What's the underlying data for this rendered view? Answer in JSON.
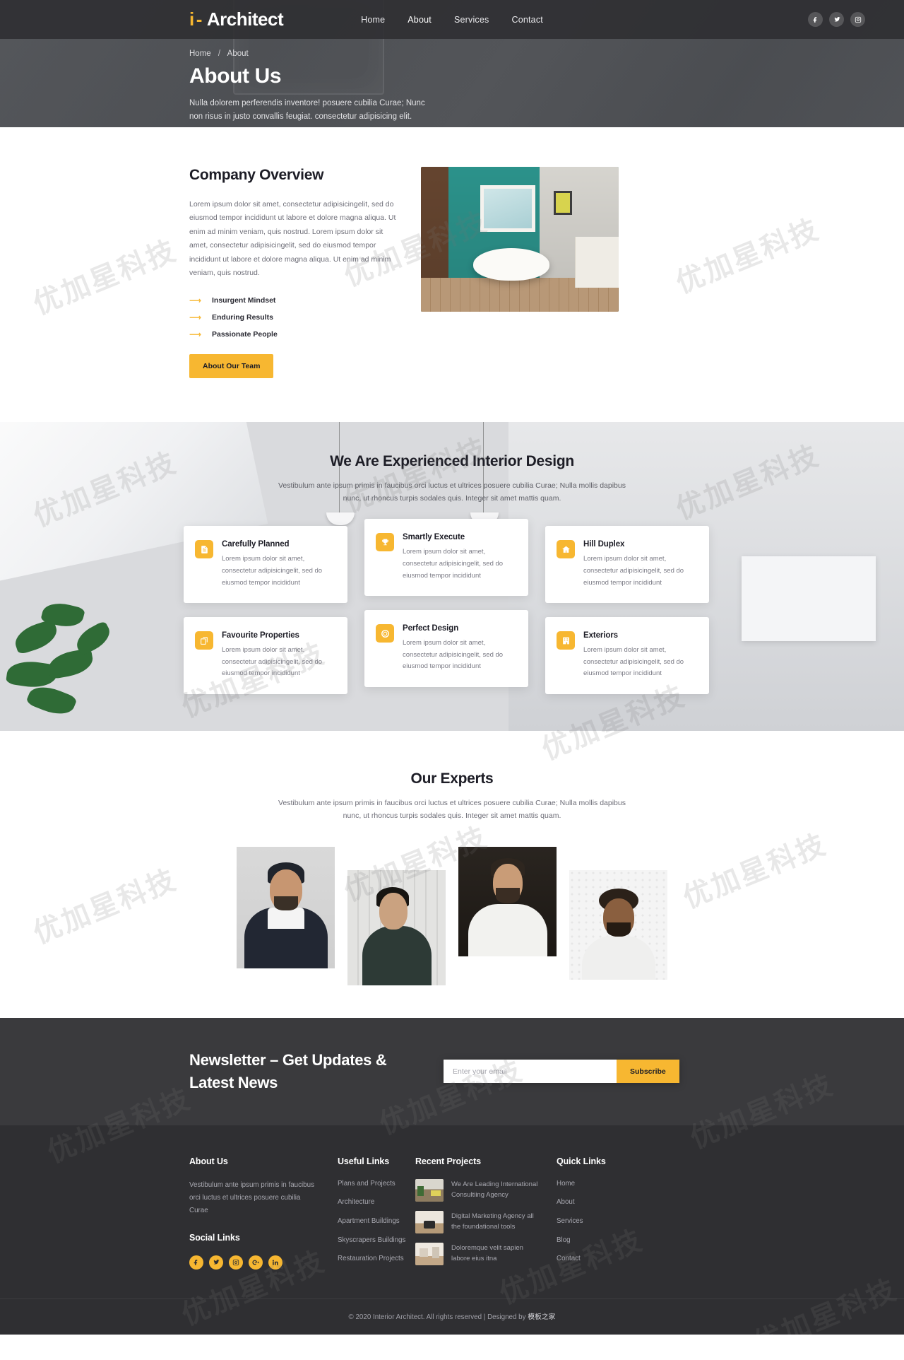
{
  "header": {
    "brand_mark": "i",
    "brand_dash": "-",
    "brand_name": "Architect",
    "nav": [
      {
        "label": "Home",
        "name": "nav-home"
      },
      {
        "label": "About",
        "name": "nav-about"
      },
      {
        "label": "Services",
        "name": "nav-services"
      },
      {
        "label": "Contact",
        "name": "nav-contact"
      }
    ],
    "social": [
      {
        "icon": "facebook-icon"
      },
      {
        "icon": "twitter-icon"
      },
      {
        "icon": "instagram-icon"
      }
    ]
  },
  "hero": {
    "breadcrumb_home": "Home",
    "breadcrumb_sep": "/",
    "breadcrumb_current": "About",
    "title": "About Us",
    "subtitle": "Nulla dolorem perferendis inventore! posuere cubilia Curae; Nunc non risus in justo convallis feugiat. consectetur adipisicing elit."
  },
  "overview": {
    "title": "Company Overview",
    "paragraph": "Lorem ipsum dolor sit amet, consectetur adipisicingelit, sed do eiusmod tempor incididunt ut labore et dolore magna aliqua. Ut enim ad minim veniam, quis nostrud. Lorem ipsum dolor sit amet, consectetur adipisicingelit, sed do eiusmod tempor incididunt ut labore et dolore magna aliqua. Ut enim ad minim veniam, quis nostrud.",
    "bullets": [
      "Insurgent Mindset",
      "Enduring Results",
      "Passionate People"
    ],
    "button": "About Our Team"
  },
  "design": {
    "title": "We Are Experienced Interior Design",
    "subtitle": "Vestibulum ante ipsum primis in faucibus orci luctus et ultrices posuere cubilia Curae; Nulla mollis dapibus nunc, ut rhoncus turpis sodales quis. Integer sit amet mattis quam.",
    "cards": [
      {
        "icon": "document-icon",
        "title": "Carefully Planned",
        "text": "Lorem ipsum dolor sit amet, consectetur adipisicingelit, sed do eiusmod tempor incididunt"
      },
      {
        "icon": "trophy-icon",
        "title": "Smartly Execute",
        "text": "Lorem ipsum dolor sit amet, consectetur adipisicingelit, sed do eiusmod tempor incididunt"
      },
      {
        "icon": "home-icon",
        "title": "Hill Duplex",
        "text": "Lorem ipsum dolor sit amet, consectetur adipisicingelit, sed do eiusmod tempor incididunt"
      },
      {
        "icon": "copy-icon",
        "title": "Favourite Properties",
        "text": "Lorem ipsum dolor sit amet, consectetur adipisicingelit, sed do eiusmod tempor incididunt"
      },
      {
        "icon": "fingerprint-icon",
        "title": "Perfect Design",
        "text": "Lorem ipsum dolor sit amet, consectetur adipisicingelit, sed do eiusmod tempor incididunt"
      },
      {
        "icon": "building-icon",
        "title": "Exteriors",
        "text": "Lorem ipsum dolor sit amet, consectetur adipisicingelit, sed do eiusmod tempor incididunt"
      }
    ]
  },
  "experts": {
    "title": "Our Experts",
    "subtitle": "Vestibulum ante ipsum primis in faucibus orci luctus et ultrices posuere cubilia Curae; Nulla mollis dapibus nunc, ut rhoncus turpis sodales quis. Integer sit amet mattis quam.",
    "members": [
      {
        "name": "expert-photo-1"
      },
      {
        "name": "expert-photo-2"
      },
      {
        "name": "expert-photo-3"
      },
      {
        "name": "expert-photo-4"
      }
    ]
  },
  "newsletter": {
    "title": "Newsletter – Get Updates & Latest News",
    "email_placeholder": "Enter your email",
    "email_value": "",
    "button": "Subscribe"
  },
  "footer": {
    "about": {
      "heading": "About Us",
      "text": "Vestibulum ante ipsum primis in faucibus orci luctus et ultrices posuere cubilia Curae",
      "social_heading": "Social Links",
      "social": [
        {
          "icon": "facebook-icon"
        },
        {
          "icon": "twitter-icon"
        },
        {
          "icon": "instagram-icon"
        },
        {
          "icon": "google-plus-icon"
        },
        {
          "icon": "linkedin-icon"
        }
      ]
    },
    "useful": {
      "heading": "Useful Links",
      "links": [
        "Plans and Projects",
        "Architecture",
        "Apartment Buildings",
        "Skyscrapers Buildings",
        "Restauration Projects"
      ]
    },
    "recent": {
      "heading": "Recent Projects",
      "items": [
        "We Are Leading International Consultiing Agency",
        "Digital Marketing Agency all the foundational tools",
        "Doloremque velit sapien labore eius itna"
      ]
    },
    "quick": {
      "heading": "Quick Links",
      "links": [
        "Home",
        "About",
        "Services",
        "Blog",
        "Contact"
      ]
    },
    "copyright_prefix": "© 2020 Interior Architect. All rights reserved | Designed by ",
    "copyright_designer": "模板之家"
  },
  "watermark": {
    "text": "优加星科技"
  },
  "colors": {
    "accent": "#f7b731",
    "dark": "#2f2f32",
    "header": "#2d2e31",
    "text": "#1d1d26",
    "muted": "#7b7b85"
  }
}
